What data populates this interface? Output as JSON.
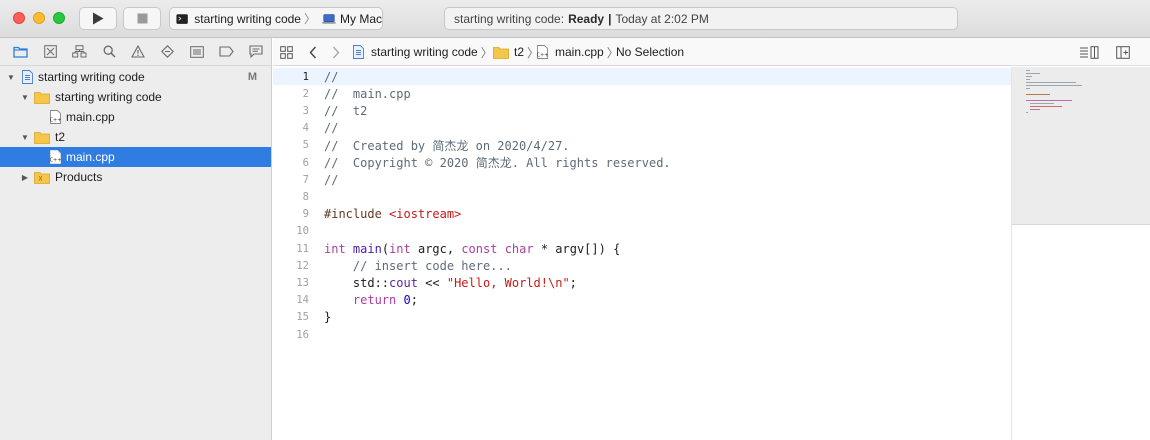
{
  "toolbar": {
    "scheme": {
      "target": "starting writing code",
      "destination": "My Mac"
    },
    "activity": {
      "prefix": "starting writing code:",
      "status": "Ready",
      "time": "Today at 2:02 PM"
    }
  },
  "navigator": {
    "tabs": [
      "folder-icon",
      "source-control-icon",
      "hierarchy-icon",
      "search-icon",
      "warning-icon",
      "test-icon",
      "debug-icon",
      "breakpoint-icon",
      "report-icon"
    ],
    "project": {
      "name": "starting writing code",
      "badge": "M"
    },
    "groups": [
      {
        "name": "starting writing code",
        "files": [
          "main.cpp"
        ]
      },
      {
        "name": "t2",
        "files": [
          "main.cpp"
        ]
      }
    ],
    "products": "Products"
  },
  "jumpbar": {
    "crumbs": [
      "starting writing code",
      "t2",
      "main.cpp"
    ],
    "selection": "No Selection"
  },
  "editor": {
    "current_line": 1,
    "lines": [
      [
        {
          "t": "//",
          "c": "comment"
        }
      ],
      [
        {
          "t": "//  main.cpp",
          "c": "comment"
        }
      ],
      [
        {
          "t": "//  t2",
          "c": "comment"
        }
      ],
      [
        {
          "t": "//",
          "c": "comment"
        }
      ],
      [
        {
          "t": "//  Created by 简杰龙 on 2020/4/27.",
          "c": "comment"
        }
      ],
      [
        {
          "t": "//  Copyright © 2020 简杰龙. All rights reserved.",
          "c": "comment"
        }
      ],
      [
        {
          "t": "//",
          "c": "comment"
        }
      ],
      [],
      [
        {
          "t": "#include ",
          "c": "preproc"
        },
        {
          "t": "<iostream>",
          "c": "string"
        }
      ],
      [],
      [
        {
          "t": "int",
          "c": "keyword"
        },
        {
          "t": " "
        },
        {
          "t": "main",
          "c": "func"
        },
        {
          "t": "("
        },
        {
          "t": "int",
          "c": "keyword"
        },
        {
          "t": " argc, "
        },
        {
          "t": "const",
          "c": "keyword"
        },
        {
          "t": " "
        },
        {
          "t": "char",
          "c": "keyword"
        },
        {
          "t": " * argv[]) {"
        }
      ],
      [
        {
          "t": "    "
        },
        {
          "t": "// insert code here...",
          "c": "comment"
        }
      ],
      [
        {
          "t": "    std::"
        },
        {
          "t": "cout",
          "c": "fn2"
        },
        {
          "t": " << "
        },
        {
          "t": "\"Hello, World!\\n\"",
          "c": "string"
        },
        {
          "t": ";"
        }
      ],
      [
        {
          "t": "    "
        },
        {
          "t": "return",
          "c": "keyword"
        },
        {
          "t": " "
        },
        {
          "t": "0",
          "c": "num"
        },
        {
          "t": ";"
        }
      ],
      [
        {
          "t": "}"
        }
      ],
      []
    ]
  }
}
